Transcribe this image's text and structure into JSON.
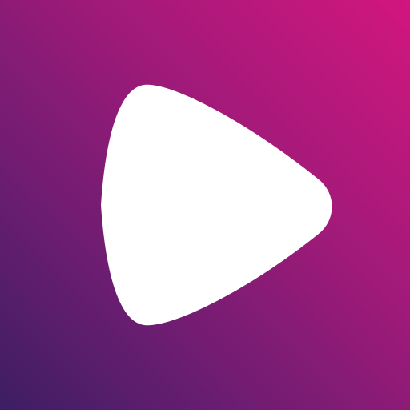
{
  "icon": {
    "name": "play-icon",
    "color": "#ffffff"
  },
  "background": {
    "colors": [
      "#3d1e63",
      "#6a1d71",
      "#a11a79",
      "#d2167e"
    ]
  }
}
